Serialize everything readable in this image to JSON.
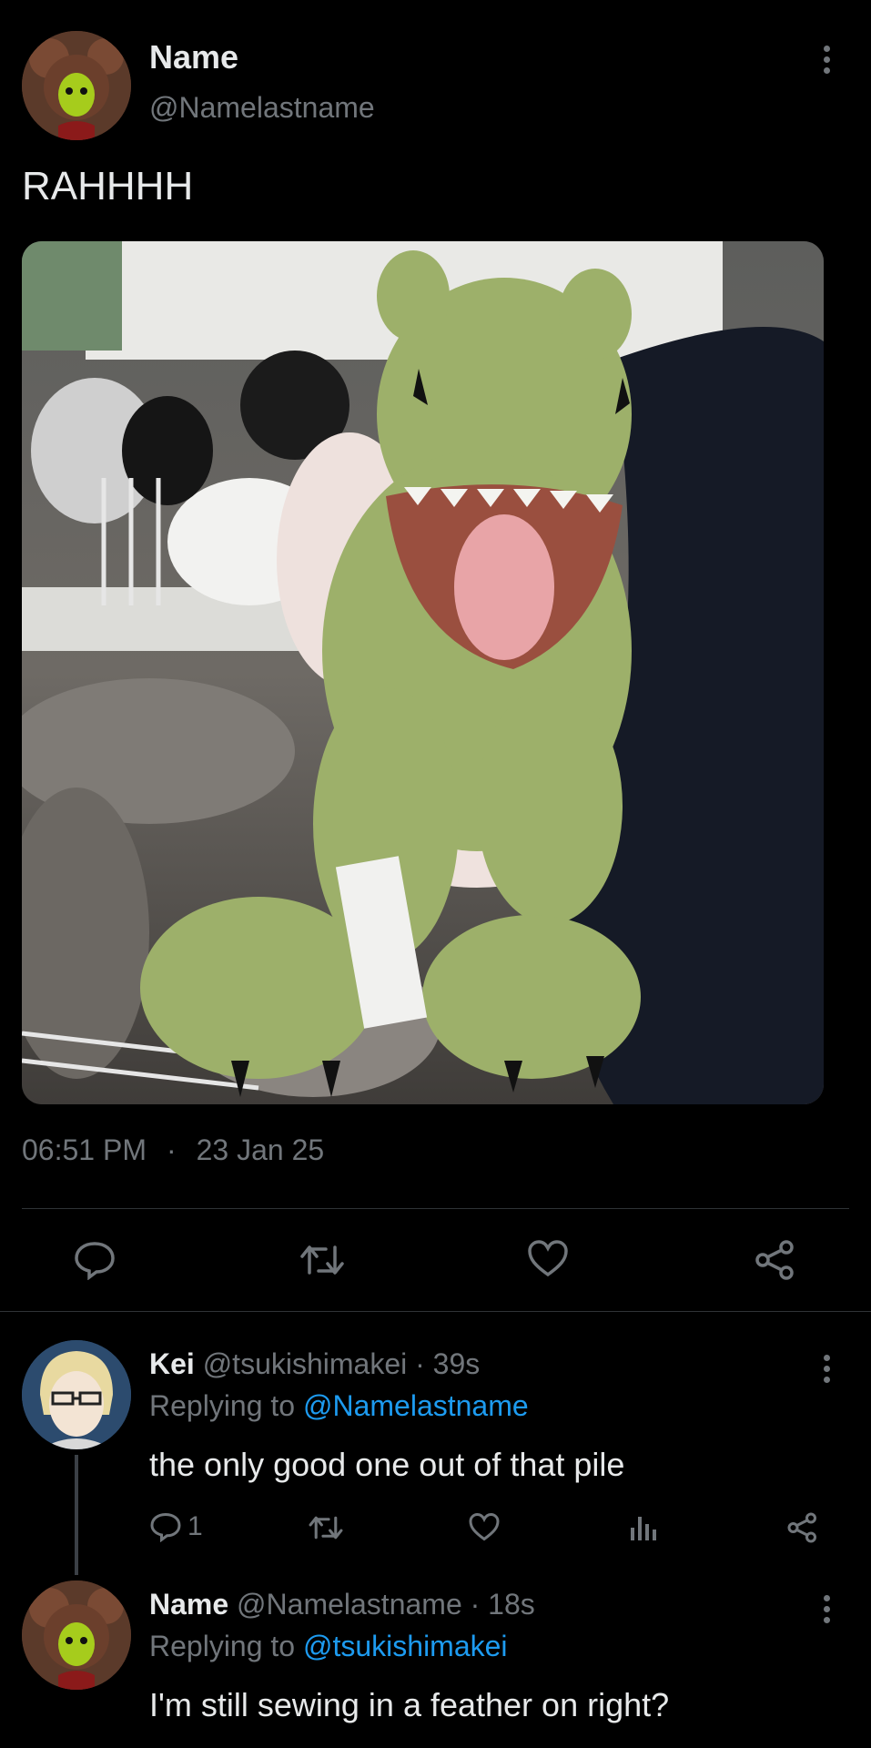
{
  "post": {
    "author_name": "Name",
    "author_handle": "@Namelastname",
    "text": "RAHHHH",
    "time": "06:51 PM",
    "separator": "·",
    "date": "23 Jan 25"
  },
  "icons": {
    "more": "more-vertical-icon",
    "reply": "reply-bubble-icon",
    "retweet": "retweet-icon",
    "like": "heart-icon",
    "share": "share-icon",
    "views": "views-bars-icon"
  },
  "replies": [
    {
      "name": "Kei",
      "handle_time": "@tsukishimakei · 39s",
      "replying_prefix": "Replying to ",
      "replying_to": "@Namelastname",
      "text": "the only good one out of that pile",
      "reply_count": "1"
    },
    {
      "name": "Name",
      "handle_time": "@Namelastname · 18s",
      "replying_prefix": "Replying to ",
      "replying_to": "@tsukishimakei",
      "text": "I'm still sewing in a feather on right?"
    }
  ],
  "colors": {
    "background": "#000000",
    "text": "#e7e9ea",
    "muted": "#71767b",
    "link": "#1d9bf0",
    "divider": "#2f3336"
  }
}
